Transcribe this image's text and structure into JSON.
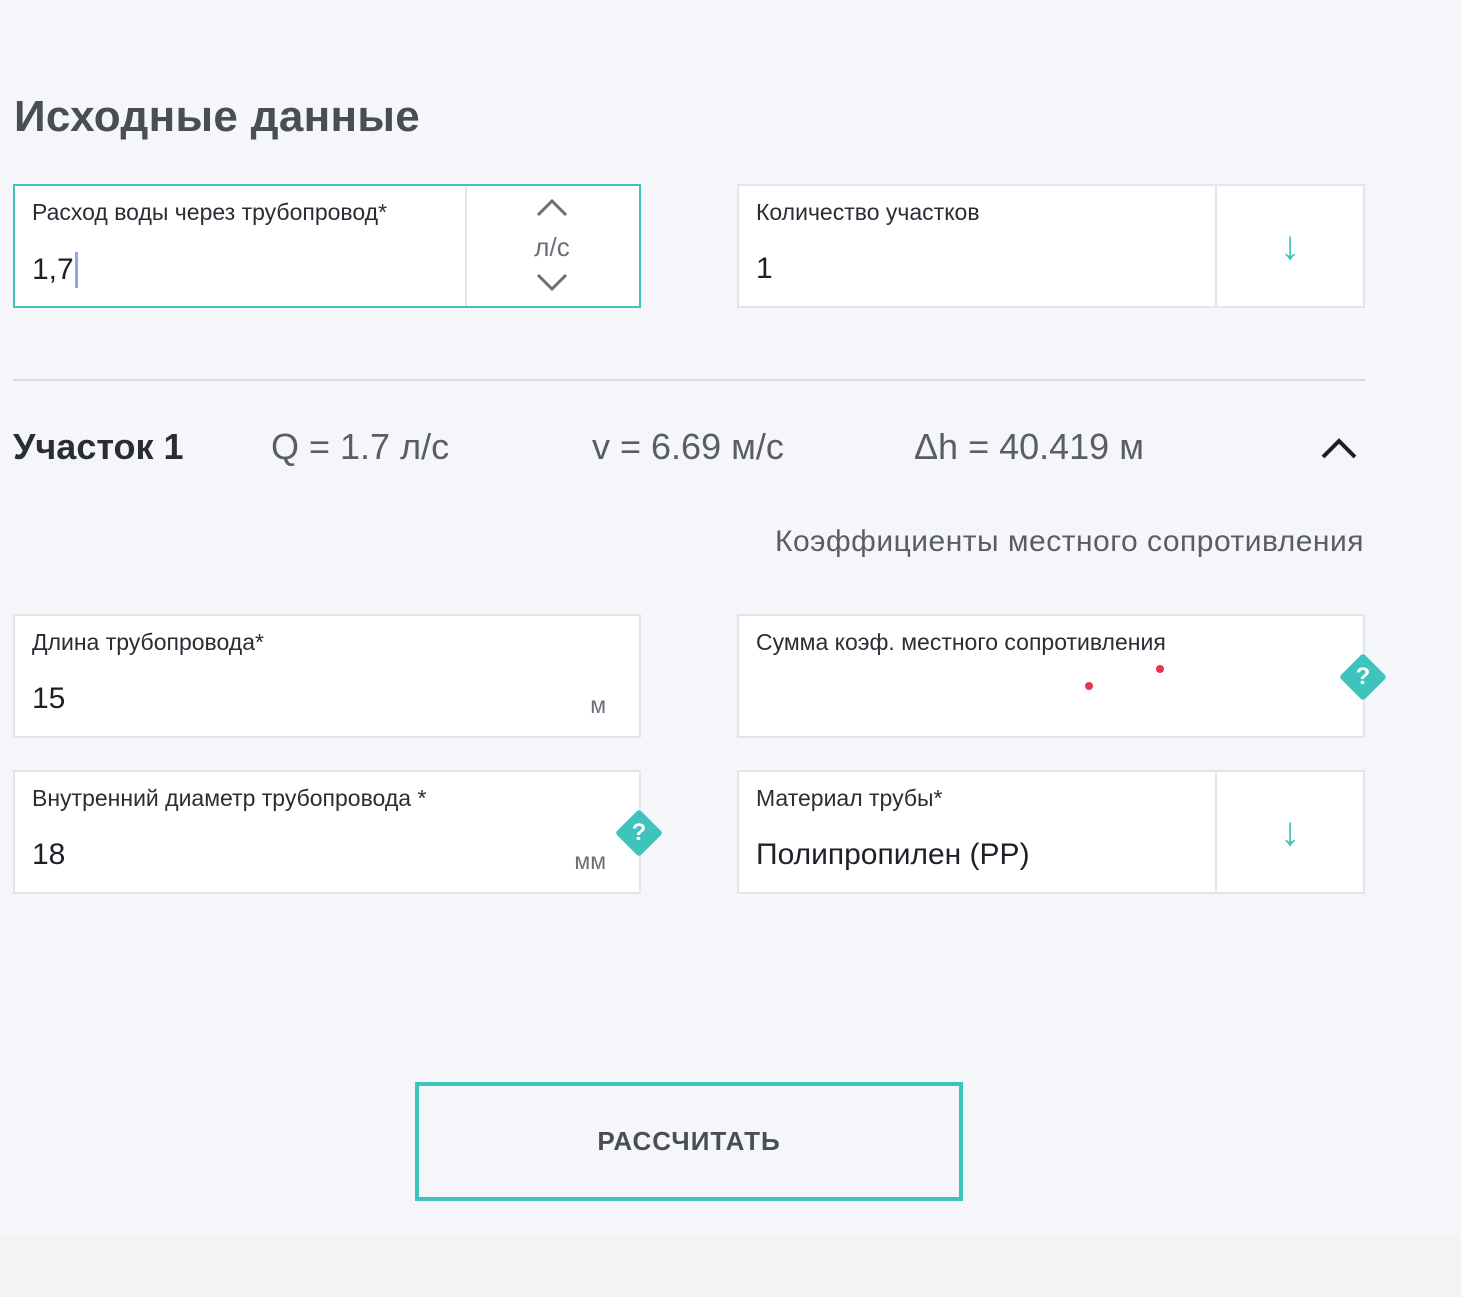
{
  "heading": "Исходные данные",
  "flow": {
    "label": "Расход воды через трубопровод*",
    "value": "1,7",
    "unit": "л/с"
  },
  "sections_count": {
    "label": "Количество участков",
    "value": "1",
    "arrow": "↓"
  },
  "section": {
    "title": "Участок 1",
    "q": "Q = 1.7 л/с",
    "v": "v = 6.69 м/с",
    "dh": "Δh = 40.419 м",
    "coef_link": "Коэффициенты местного сопротивления"
  },
  "length": {
    "label": "Длина трубопровода*",
    "value": "15",
    "unit": "м"
  },
  "coef_sum": {
    "label": "Сумма коэф. местного сопротивления",
    "value": "",
    "help": "?"
  },
  "diameter": {
    "label": "Внутренний диаметр трубопровода *",
    "value": "18",
    "unit": "мм",
    "help": "?"
  },
  "material": {
    "label": "Материал трубы*",
    "value": "Полипропилен (PP)",
    "arrow": "↓"
  },
  "calculate_button": "РАССЧИТАТЬ",
  "colors": {
    "accent": "#3fc4bd",
    "background": "#f4f6fa",
    "text": "#2b2d35",
    "marker": "#e8344a"
  }
}
